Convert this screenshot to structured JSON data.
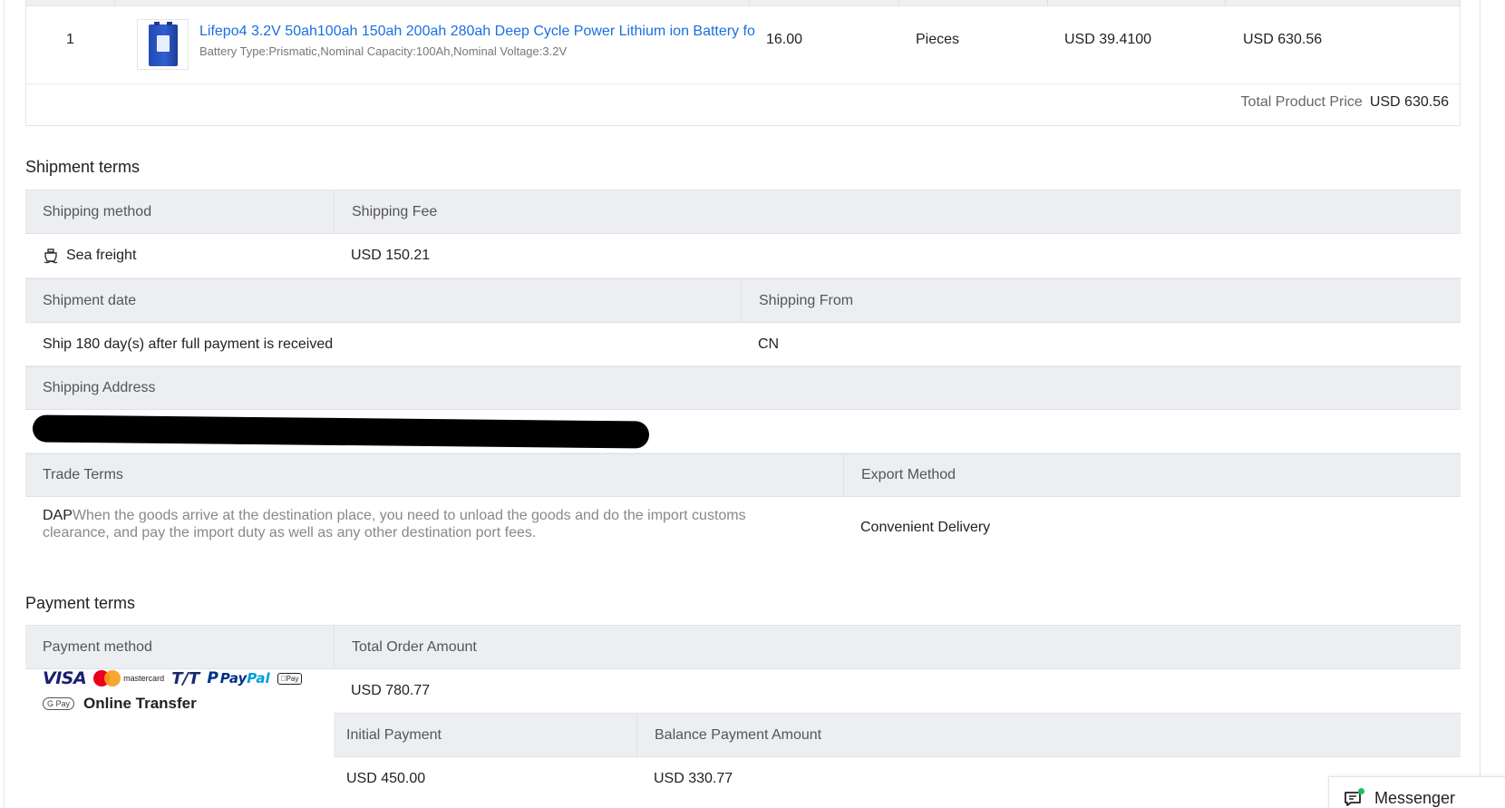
{
  "product": {
    "index": "1",
    "title": "Lifepo4 3.2V 50ah100ah 150ah 200ah 280ah Deep Cycle Power Lithium ion Battery fo",
    "attributes": "Battery Type:Prismatic,Nominal Capacity:100Ah,Nominal Voltage:3.2V",
    "quantity": "16.00",
    "unit": "Pieces",
    "unit_price": "USD 39.4100",
    "amount": "USD 630.56",
    "total_label": "Total Product Price",
    "total_value": "USD 630.56"
  },
  "shipment": {
    "title": "Shipment terms",
    "method_label": "Shipping method",
    "fee_label": "Shipping Fee",
    "method_value": "Sea freight",
    "fee_value": "USD 150.21",
    "date_label": "Shipment date",
    "from_label": "Shipping From",
    "date_value": "Ship 180 day(s) after full payment is received",
    "from_value": "CN",
    "address_label": "Shipping Address",
    "trade_label": "Trade Terms",
    "export_label": "Export Method",
    "trade_code": "DAP",
    "trade_desc": "When the goods arrive at the destination place, you need to unload the goods and do the import customs clearance, and pay the import duty as well as any other destination port fees.",
    "export_value": "Convenient Delivery"
  },
  "payment": {
    "title": "Payment terms",
    "method_label": "Payment method",
    "total_label": "Total Order Amount",
    "total_value": "USD 780.77",
    "initial_label": "Initial Payment",
    "balance_label": "Balance Payment Amount",
    "initial_value": "USD 450.00",
    "balance_value": "USD 330.77",
    "logos": {
      "visa": "VISA",
      "mastercard": "mastercard",
      "tt": "T/T",
      "paypal_a": "Pay",
      "paypal_b": "Pal",
      "applepay": "Pay",
      "googlepay": "G Pay",
      "online_transfer": "Online Transfer"
    }
  },
  "messenger": {
    "label": "Messenger",
    "status_color": "#20c05c"
  },
  "colors": {
    "link": "#1a6fe0",
    "header_bg": "#eceef1"
  }
}
